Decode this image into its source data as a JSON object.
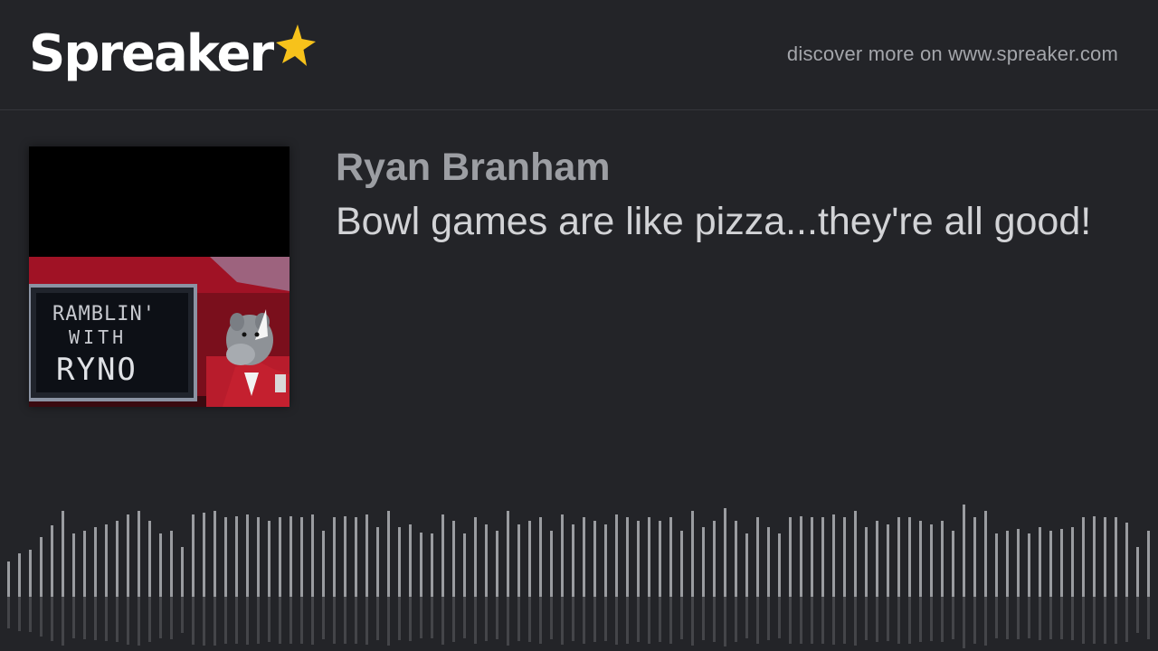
{
  "header": {
    "logo_text": "Spreaker",
    "logo_star_color": "#f7c21b",
    "discover_text": "discover more on www.spreaker.com"
  },
  "episode": {
    "author": "Ryan Branham",
    "title": "Bowl games are like pizza...they're all good!",
    "cover_art": {
      "line1": "RAMBLIN'",
      "line2": "WITH",
      "line3": "RYNO"
    }
  },
  "colors": {
    "background": "#232428",
    "waveform_bar": "#9a9ca0",
    "author": "#9c9ea3",
    "title": "#d2d3d6"
  },
  "waveform": {
    "levels": [
      0.55,
      0.6,
      0.62,
      0.7,
      0.77,
      0.86,
      0.72,
      0.74,
      0.76,
      0.78,
      0.8,
      0.84,
      0.86,
      0.8,
      0.72,
      0.74,
      0.64,
      0.84,
      0.85,
      0.86,
      0.82,
      0.83,
      0.84,
      0.82,
      0.8,
      0.82,
      0.83,
      0.82,
      0.84,
      0.74,
      0.82,
      0.83,
      0.82,
      0.84,
      0.76,
      0.86,
      0.76,
      0.78,
      0.73,
      0.72,
      0.84,
      0.8,
      0.72,
      0.82,
      0.78,
      0.74,
      0.86,
      0.78,
      0.8,
      0.82,
      0.74,
      0.84,
      0.78,
      0.82,
      0.8,
      0.78,
      0.84,
      0.82,
      0.8,
      0.82,
      0.8,
      0.82,
      0.74,
      0.86,
      0.76,
      0.8,
      0.88,
      0.8,
      0.72,
      0.82,
      0.76,
      0.72,
      0.82,
      0.83,
      0.82,
      0.82,
      0.84,
      0.82,
      0.86,
      0.76,
      0.8,
      0.78,
      0.82,
      0.82,
      0.8,
      0.78,
      0.8,
      0.74,
      0.9,
      0.82,
      0.86,
      0.72,
      0.74,
      0.75,
      0.72,
      0.76,
      0.74,
      0.75,
      0.76,
      0.82,
      0.83,
      0.82,
      0.82,
      0.79,
      0.64,
      0.74,
      0.86,
      0.76,
      0.74,
      0.72,
      0.78,
      0.86,
      0.74,
      0.72,
      0.82,
      0.78,
      0.62,
      0.52,
      0.58,
      0.6,
      0.78,
      0.74,
      0.74
    ]
  }
}
